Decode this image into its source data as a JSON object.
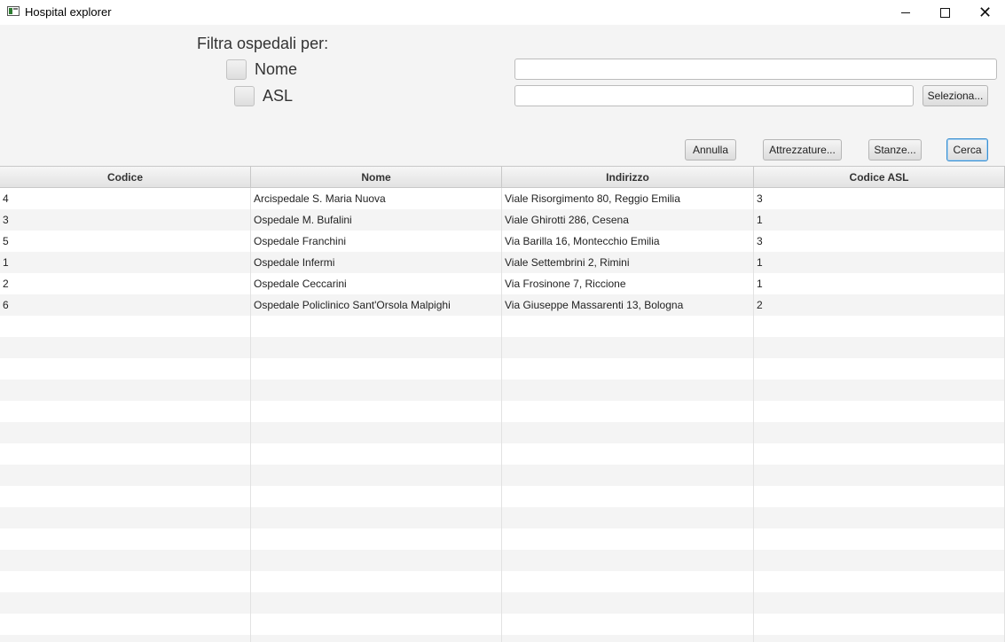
{
  "window": {
    "title": "Hospital explorer"
  },
  "filter": {
    "heading": "Filtra ospedali per:",
    "nome_label": "Nome",
    "asl_label": "ASL",
    "nome_value": "",
    "asl_value": "",
    "seleziona_label": "Seleziona..."
  },
  "actions": {
    "annulla": "Annulla",
    "attrezzature": "Attrezzature...",
    "stanze": "Stanze...",
    "cerca": "Cerca"
  },
  "table": {
    "columns": [
      "Codice",
      "Nome",
      "Indirizzo",
      "Codice ASL"
    ],
    "rows": [
      [
        "4",
        "Arcispedale S. Maria Nuova",
        "Viale Risorgimento 80, Reggio Emilia",
        "3"
      ],
      [
        "3",
        "Ospedale M. Bufalini",
        "Viale Ghirotti 286, Cesena",
        "1"
      ],
      [
        "5",
        "Ospedale Franchini",
        "Via Barilla 16, Montecchio Emilia",
        "3"
      ],
      [
        "1",
        "Ospedale Infermi",
        "Viale Settembrini 2, Rimini",
        "1"
      ],
      [
        "2",
        "Ospedale Ceccarini",
        "Via Frosinone 7, Riccione",
        "1"
      ],
      [
        "6",
        "Ospedale Policlinico Sant'Orsola Malpighi",
        "Via Giuseppe Massarenti 13, Bologna",
        "2"
      ]
    ]
  }
}
